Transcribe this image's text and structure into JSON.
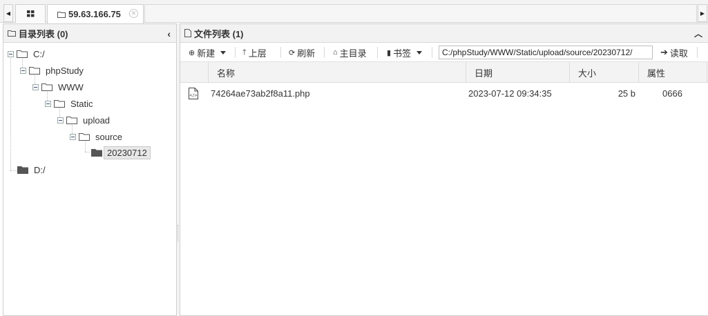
{
  "tabs": {
    "active_title": "59.63.166.75"
  },
  "left_panel": {
    "title": "目录列表 (0)",
    "tree": [
      "C:/",
      "phpStudy",
      "WWW",
      "Static",
      "upload",
      "source",
      "20230712",
      "D:/"
    ]
  },
  "right_panel": {
    "title": "文件列表 (1)",
    "toolbar": {
      "new_label": "新建",
      "up_label": "上层",
      "refresh_label": "刷新",
      "home_label": "主目录",
      "bookmark_label": "书签",
      "path_value": "C:/phpStudy/WWW/Static/upload/source/20230712/",
      "read_label": "读取"
    },
    "columns": [
      "名称",
      "日期",
      "大小",
      "属性"
    ],
    "files": [
      {
        "name": "74264ae73ab2f8a11.php",
        "date": "2023-07-12 09:34:35",
        "size": "25 b",
        "attr": "0666"
      }
    ]
  },
  "icons": {
    "tab_home": "grid-icon",
    "folder": "folder-icon",
    "file": "php-file-icon"
  }
}
